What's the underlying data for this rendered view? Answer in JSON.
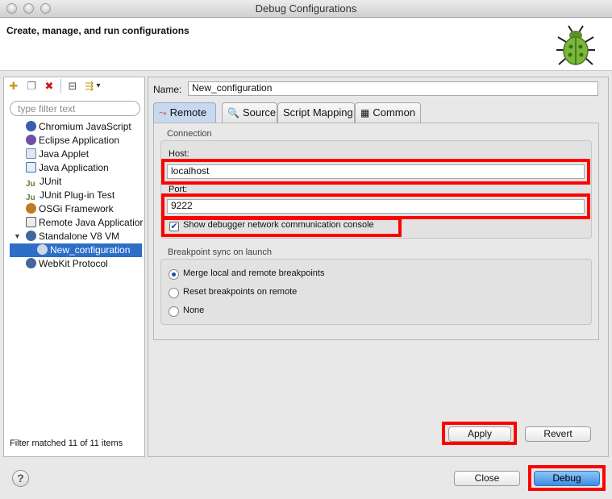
{
  "window": {
    "title": "Debug Configurations"
  },
  "banner": {
    "title": "Create, manage, and run configurations",
    "icon": "bug-icon"
  },
  "sidebar": {
    "toolbar": [
      {
        "name": "new-launch-config-icon",
        "glyph": "✚"
      },
      {
        "name": "duplicate-icon",
        "glyph": "❐"
      },
      {
        "name": "delete-icon",
        "glyph": "✖"
      },
      {
        "name": "collapse-all-icon",
        "glyph": "⊟"
      },
      {
        "name": "filter-icon",
        "glyph": "⇶"
      },
      {
        "name": "chevron-down-icon",
        "glyph": "▾"
      }
    ],
    "filter_placeholder": "type filter text",
    "items": [
      {
        "label": "Chromium JavaScript",
        "color": "#3a5fa8"
      },
      {
        "label": "Eclipse Application",
        "color": "#6b52a8"
      },
      {
        "label": "Java Applet",
        "color": "#7a8aa6"
      },
      {
        "label": "Java Application",
        "color": "#3b6fb0"
      },
      {
        "label": "JUnit",
        "color": "#5c7d2e"
      },
      {
        "label": "JUnit Plug-in Test",
        "color": "#6a7e3b"
      },
      {
        "label": "OSGi Framework",
        "color": "#c07a24"
      },
      {
        "label": "Remote Java Applicatior",
        "color": "#5a5a5a"
      },
      {
        "label": "Standalone V8 VM",
        "color": "#40689c"
      },
      {
        "label": "New_configuration",
        "color": "#cfd8e6"
      },
      {
        "label": "WebKit Protocol",
        "color": "#40689c"
      }
    ],
    "filter_status": "Filter matched 11 of 11 items"
  },
  "config": {
    "name_label": "Name:",
    "name_value": "New_configuration",
    "tabs": [
      {
        "label": "Remote",
        "glyph": "⤳"
      },
      {
        "label": "Source",
        "glyph": "🔍"
      },
      {
        "label": "Script Mapping",
        "glyph": ""
      },
      {
        "label": "Common",
        "glyph": "▦"
      }
    ],
    "connection": {
      "title": "Connection",
      "host_label": "Host:",
      "host_value": "localhost",
      "port_label": "Port:",
      "port_value": "9222",
      "console_checkbox_label": "Show debugger network communication console",
      "console_checked": true
    },
    "breakpoint_sync": {
      "title": "Breakpoint sync on launch",
      "options": [
        {
          "label": "Merge local and remote breakpoints",
          "selected": true
        },
        {
          "label": "Reset breakpoints on remote",
          "selected": false
        },
        {
          "label": "None",
          "selected": false
        }
      ]
    },
    "apply_label": "Apply",
    "revert_label": "Revert"
  },
  "footer": {
    "help_glyph": "?",
    "close_label": "Close",
    "debug_label": "Debug"
  },
  "colors": {
    "highlight": "#ff0000",
    "selection": "#2d6ec7"
  }
}
